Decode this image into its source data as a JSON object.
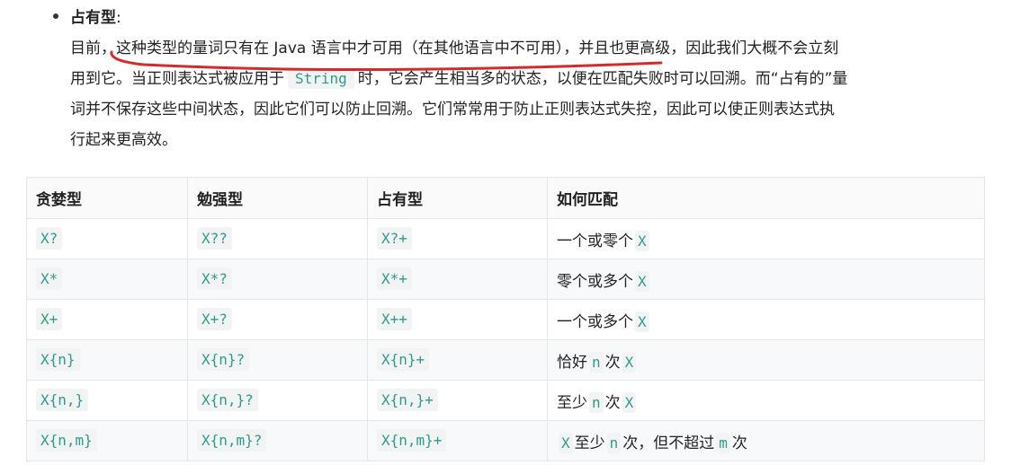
{
  "bullet": {
    "term": "占有型",
    "colon": ":"
  },
  "paragraph": {
    "l1": "目前，这种类型的量词只有在 Java 语言中才可用（在其他语言中不可用），并且也更高级，因此我们大概不会立刻",
    "l2_pre": "用到它。当正则表达式被应用于",
    "l2_code": "String",
    "l2_post": "时，它会产生相当多的状态，以便在匹配失败时可以回溯。而“占有的”量",
    "l3": "词并不保存这些中间状态，因此它们可以防止回溯。它们常常用于防止正则表达式失控，因此可以使正则表达式执",
    "l4": "行起来更高效。"
  },
  "table": {
    "headers": [
      "贪婪型",
      "勉强型",
      "占有型",
      "如何匹配"
    ],
    "rows": [
      {
        "greedy": "X?",
        "reluctant": "X??",
        "possessive": "X?+",
        "desc": {
          "a": "一个或零个",
          "c1": "X"
        }
      },
      {
        "greedy": "X*",
        "reluctant": "X*?",
        "possessive": "X*+",
        "desc": {
          "a": "零个或多个",
          "c1": "X"
        }
      },
      {
        "greedy": "X+",
        "reluctant": "X+?",
        "possessive": "X++",
        "desc": {
          "a": "一个或多个",
          "c1": "X"
        }
      },
      {
        "greedy": "X{n}",
        "reluctant": "X{n}?",
        "possessive": "X{n}+",
        "desc": {
          "a": "恰好",
          "c1": "n",
          "b": "次",
          "c2": "X"
        }
      },
      {
        "greedy": "X{n,}",
        "reluctant": "X{n,}?",
        "possessive": "X{n,}+",
        "desc": {
          "a": "至少",
          "c1": "n",
          "b": "次",
          "c2": "X"
        }
      },
      {
        "greedy": "X{n,m}",
        "reluctant": "X{n,m}?",
        "possessive": "X{n,m}+",
        "desc": {
          "c0": "X",
          "a": "至少",
          "c1": "n",
          "b": "次，但不超过",
          "c2": "m",
          "d": "次"
        }
      }
    ]
  },
  "annotation": {
    "underline_color": "#d42a2a"
  }
}
